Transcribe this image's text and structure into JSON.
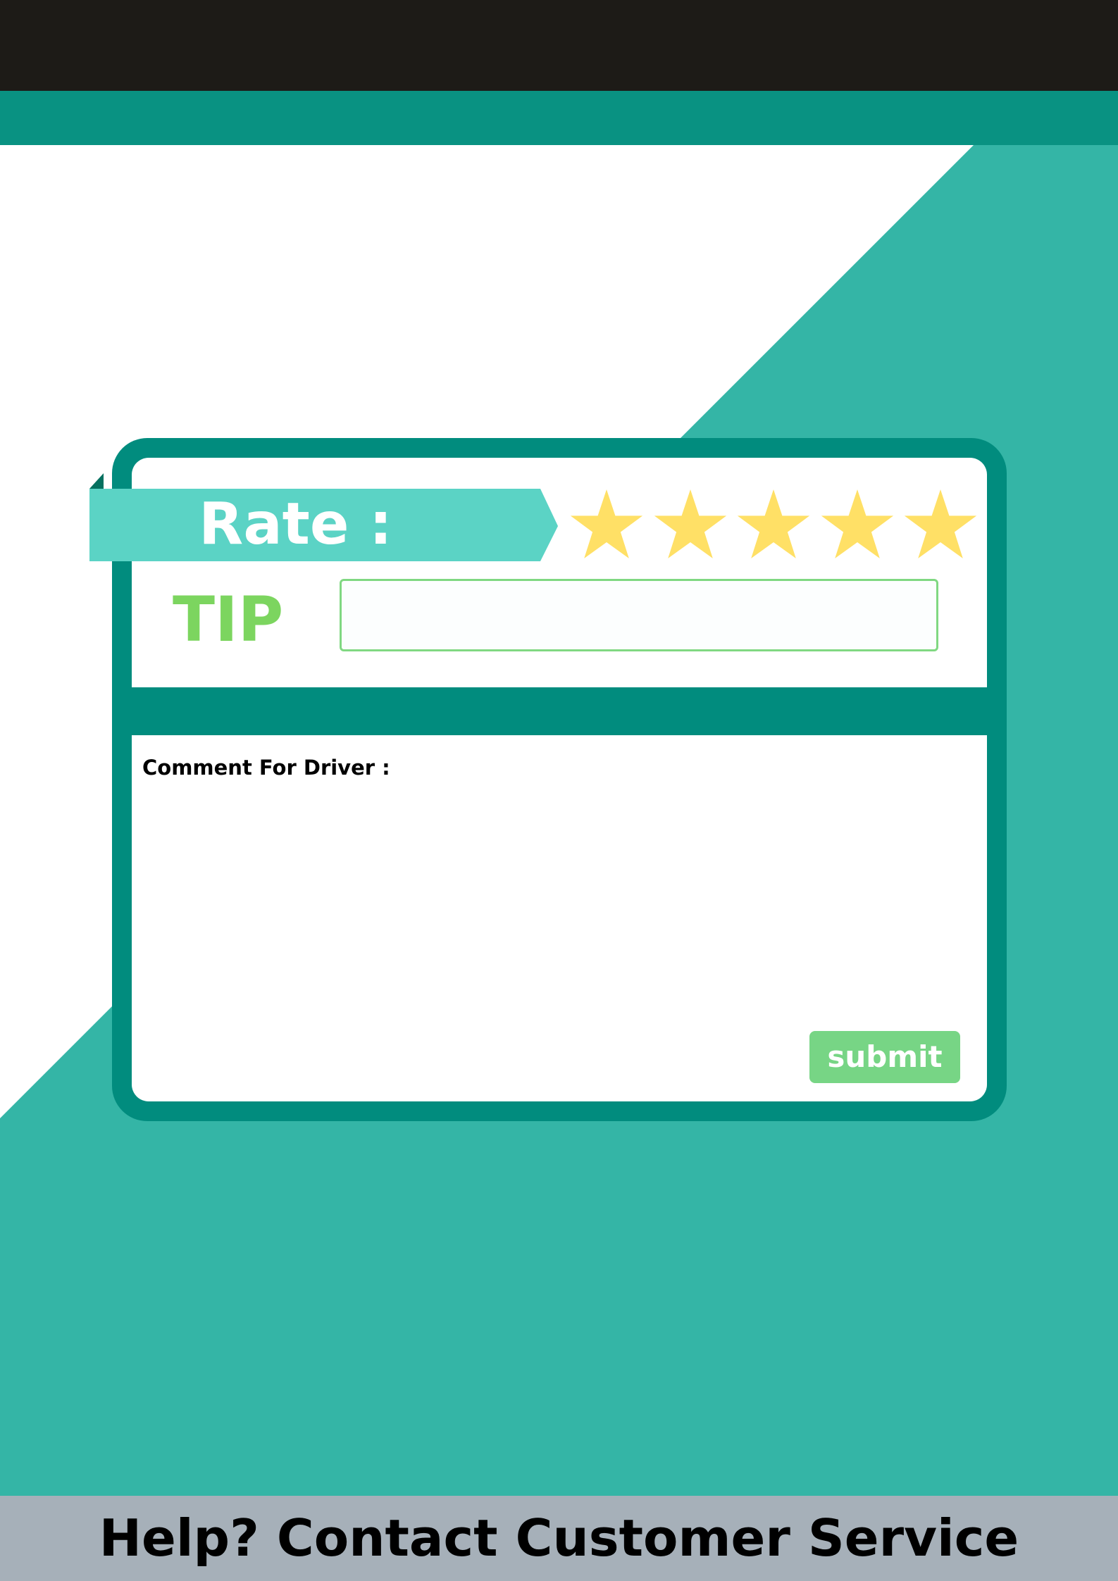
{
  "colors": {
    "top_bar": "#1d1b17",
    "teal_band": "#099282",
    "background_teal": "#34b5a6",
    "background_white": "#ffffff",
    "card_border": "#018c7e",
    "rate_ribbon": "#5bd3c5",
    "star": "#ffe066",
    "tip_label": "#7cd55f",
    "tip_input_border": "#80d882",
    "submit_button": "#77d585",
    "footer": "#a6b0b9"
  },
  "rating": {
    "label": "Rate :",
    "stars_total": 5,
    "stars_filled": 5,
    "star_icon": "star-icon"
  },
  "tip": {
    "label": "TIP",
    "value": "",
    "placeholder": ""
  },
  "comment": {
    "label": "Comment For Driver :",
    "value": ""
  },
  "submit": {
    "label": "submit"
  },
  "footer": {
    "text": "Help? Contact Customer Service"
  }
}
